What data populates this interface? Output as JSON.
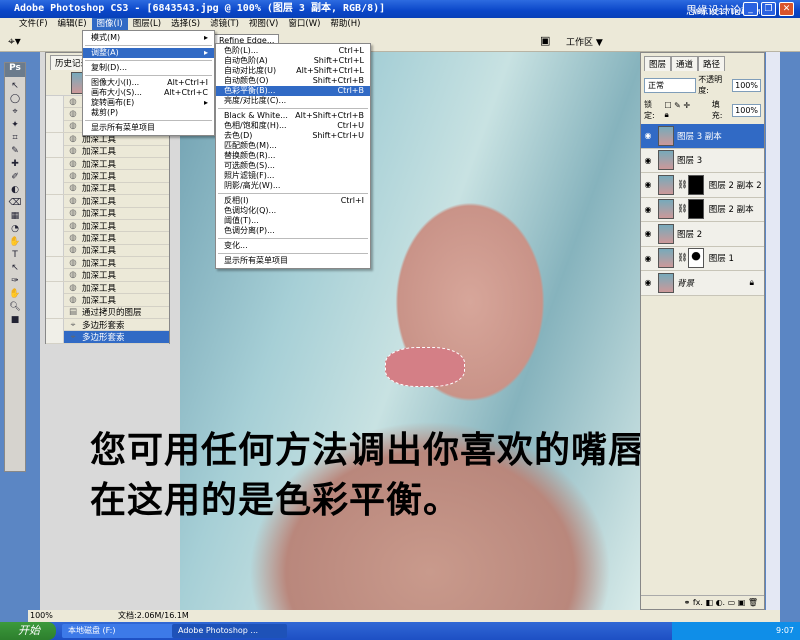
{
  "window": {
    "title": "Adobe Photoshop CS3 - [6843543.jpg @ 100% (图层 3 副本, RGB/8)]",
    "watermark": "思缘设计论坛",
    "watermark_url": "WWW.MISSYUAN.COM"
  },
  "menubar": [
    "文件(F)",
    "编辑(E)",
    "图像(I)",
    "图层(L)",
    "选择(S)",
    "滤镜(T)",
    "视图(V)",
    "窗口(W)",
    "帮助(H)"
  ],
  "options": {
    "refine_edge": "Refine Edge...",
    "workspace": "工作区 ▼"
  },
  "image_menu": [
    {
      "label": "模式(M)",
      "sub": true
    },
    {
      "sep": true
    },
    {
      "label": "调整(A)",
      "sub": true,
      "hl": true
    },
    {
      "sep": true
    },
    {
      "label": "复制(D)..."
    },
    {
      "sep": true
    },
    {
      "label": "图像大小(I)...",
      "key": "Alt+Ctrl+I"
    },
    {
      "label": "画布大小(S)...",
      "key": "Alt+Ctrl+C"
    },
    {
      "label": "旋转画布(E)",
      "sub": true
    },
    {
      "label": "裁剪(P)"
    },
    {
      "sep": true
    },
    {
      "label": "显示所有菜单项目"
    }
  ],
  "adjust_menu": [
    {
      "label": "色阶(L)...",
      "key": "Ctrl+L"
    },
    {
      "label": "自动色阶(A)",
      "key": "Shift+Ctrl+L"
    },
    {
      "label": "自动对比度(U)",
      "key": "Alt+Shift+Ctrl+L"
    },
    {
      "label": "自动颜色(O)",
      "key": "Shift+Ctrl+B"
    },
    {
      "label": "色彩平衡(B)...",
      "key": "Ctrl+B",
      "hl": true
    },
    {
      "label": "亮度/对比度(C)..."
    },
    {
      "sep": true
    },
    {
      "label": "Black & White...",
      "key": "Alt+Shift+Ctrl+B"
    },
    {
      "label": "色相/饱和度(H)...",
      "key": "Ctrl+U"
    },
    {
      "label": "去色(D)",
      "key": "Shift+Ctrl+U"
    },
    {
      "label": "匹配颜色(M)..."
    },
    {
      "label": "替换颜色(R)..."
    },
    {
      "label": "可选颜色(S)..."
    },
    {
      "label": "照片滤镜(F)..."
    },
    {
      "label": "阴影/高光(W)..."
    },
    {
      "sep": true
    },
    {
      "label": "反相(I)",
      "key": "Ctrl+I"
    },
    {
      "label": "色调均化(Q)..."
    },
    {
      "label": "阈值(T)..."
    },
    {
      "label": "色调分离(P)..."
    },
    {
      "sep": true
    },
    {
      "label": "变化..."
    },
    {
      "sep": true
    },
    {
      "label": "显示所有菜单项目"
    }
  ],
  "history": {
    "tab": "历史记录",
    "items": [
      "加深工具",
      "加深工具",
      "加深工具",
      "加深工具",
      "加深工具",
      "加深工具",
      "加深工具",
      "加深工具",
      "加深工具",
      "加深工具",
      "加深工具",
      "加深工具",
      "加深工具",
      "加深工具",
      "加深工具",
      "加深工具",
      "加深工具",
      "通过拷贝的图层",
      "多边形套索",
      "多边形套索"
    ],
    "selected": 19
  },
  "layers": {
    "tabs": [
      "图层",
      "通道",
      "路径"
    ],
    "blend": "正常",
    "opacity_label": "不透明度:",
    "opacity": "100%",
    "lock_label": "锁定:",
    "fill_label": "填充:",
    "fill": "100%",
    "items": [
      {
        "name": "图层 3 副本",
        "sel": true
      },
      {
        "name": "图层 3"
      },
      {
        "name": "图层 2 副本 2",
        "mask": "black"
      },
      {
        "name": "图层 2 副本",
        "mask": "black"
      },
      {
        "name": "图层 2"
      },
      {
        "name": "图层 1",
        "mask": "white"
      },
      {
        "name": "背景",
        "lock": true
      }
    ]
  },
  "caption": "您可用任何方法调出你喜欢的嘴唇色彩，在这用的是色彩平衡。",
  "status": {
    "zoom": "100%",
    "doc": "文档:2.06M/16.1M"
  },
  "taskbar": {
    "start": "开始",
    "tasks": [
      "本地磁盘 (F:)",
      "Adobe Photoshop ..."
    ],
    "clock": "9:07"
  }
}
